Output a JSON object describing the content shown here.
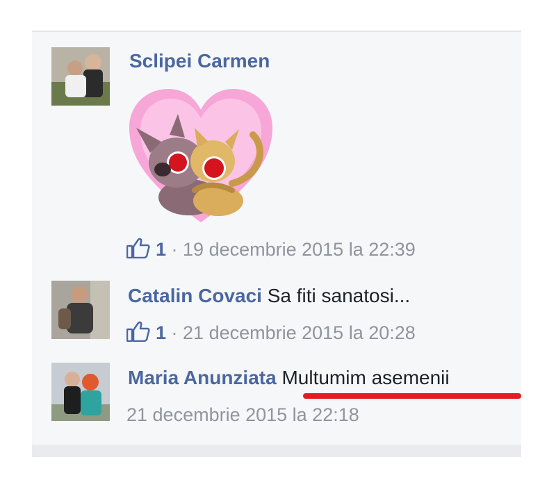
{
  "comments": [
    {
      "author": "Sclipei Carmen",
      "text": "",
      "has_sticker": true,
      "sticker": "heart-cats-hug-sticker",
      "likes": "1",
      "separator": " · ",
      "timestamp": "19 decembrie 2015 la 22:39"
    },
    {
      "author": "Catalin Covaci",
      "text": "Sa fiti sanatosi...",
      "likes": "1",
      "separator": " · ",
      "timestamp": "21 decembrie 2015 la 20:28"
    },
    {
      "author": "Maria Anunziata",
      "text": "Multumim asemenii",
      "timestamp": "21 decembrie 2015 la 22:18"
    }
  ],
  "colors": {
    "author_link": "#4b67a1",
    "meta_text": "#90949c",
    "panel_bg": "#f6f7f9",
    "highlight_underline": "#e31b23"
  },
  "icons": {
    "like": "thumbs-up-icon"
  }
}
